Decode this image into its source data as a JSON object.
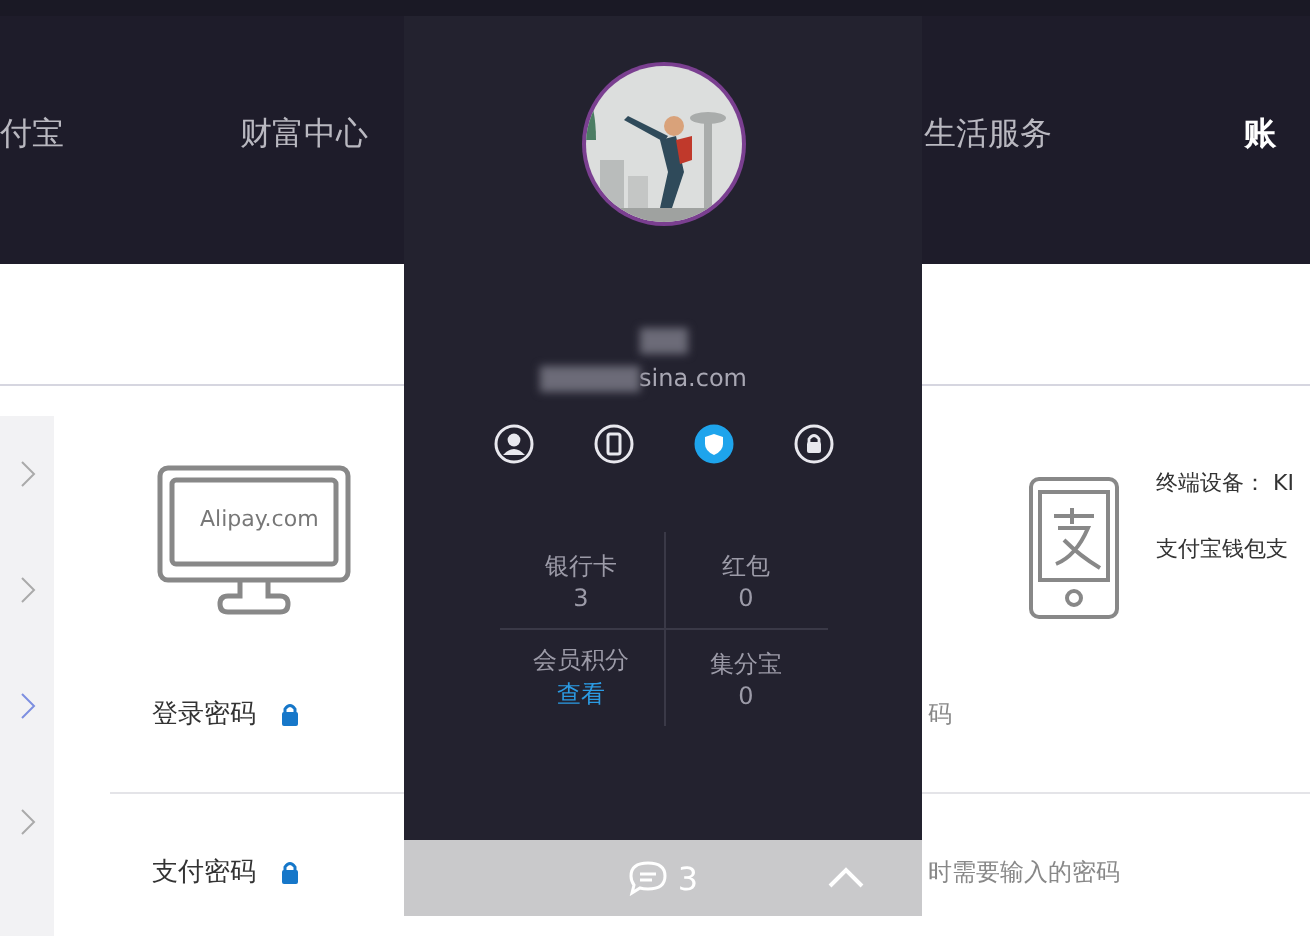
{
  "nav": [
    {
      "label": "付宝",
      "selected": false
    },
    {
      "label": "财富中心",
      "selected": false
    },
    {
      "label": "生活服务",
      "selected": false
    },
    {
      "label": "账",
      "selected": true
    }
  ],
  "sidebar": [
    {
      "selected": false
    },
    {
      "selected": false
    },
    {
      "selected": true
    },
    {
      "selected": false
    }
  ],
  "content": {
    "monitor_label": "Alipay.com",
    "device_label": "终端设备： KI",
    "wallet_text": "支付宝钱包支",
    "rows": [
      {
        "title": "登录密码",
        "tail": "码"
      },
      {
        "title": "支付密码",
        "tail": "时需要输入的密码"
      }
    ]
  },
  "popup": {
    "email": "sina.com",
    "icons": [
      {
        "kind": "user",
        "selected": false
      },
      {
        "kind": "phone",
        "selected": false
      },
      {
        "kind": "shield",
        "selected": true
      },
      {
        "kind": "lock",
        "selected": false
      }
    ],
    "stats": [
      {
        "label": "银行卡",
        "value": "3",
        "link": false
      },
      {
        "label": "红包",
        "value": "0",
        "link": false
      },
      {
        "label": "会员积分",
        "value": "查看",
        "link": true
      },
      {
        "label": "集分宝",
        "value": "0",
        "link": false
      }
    ],
    "messages": "3"
  }
}
